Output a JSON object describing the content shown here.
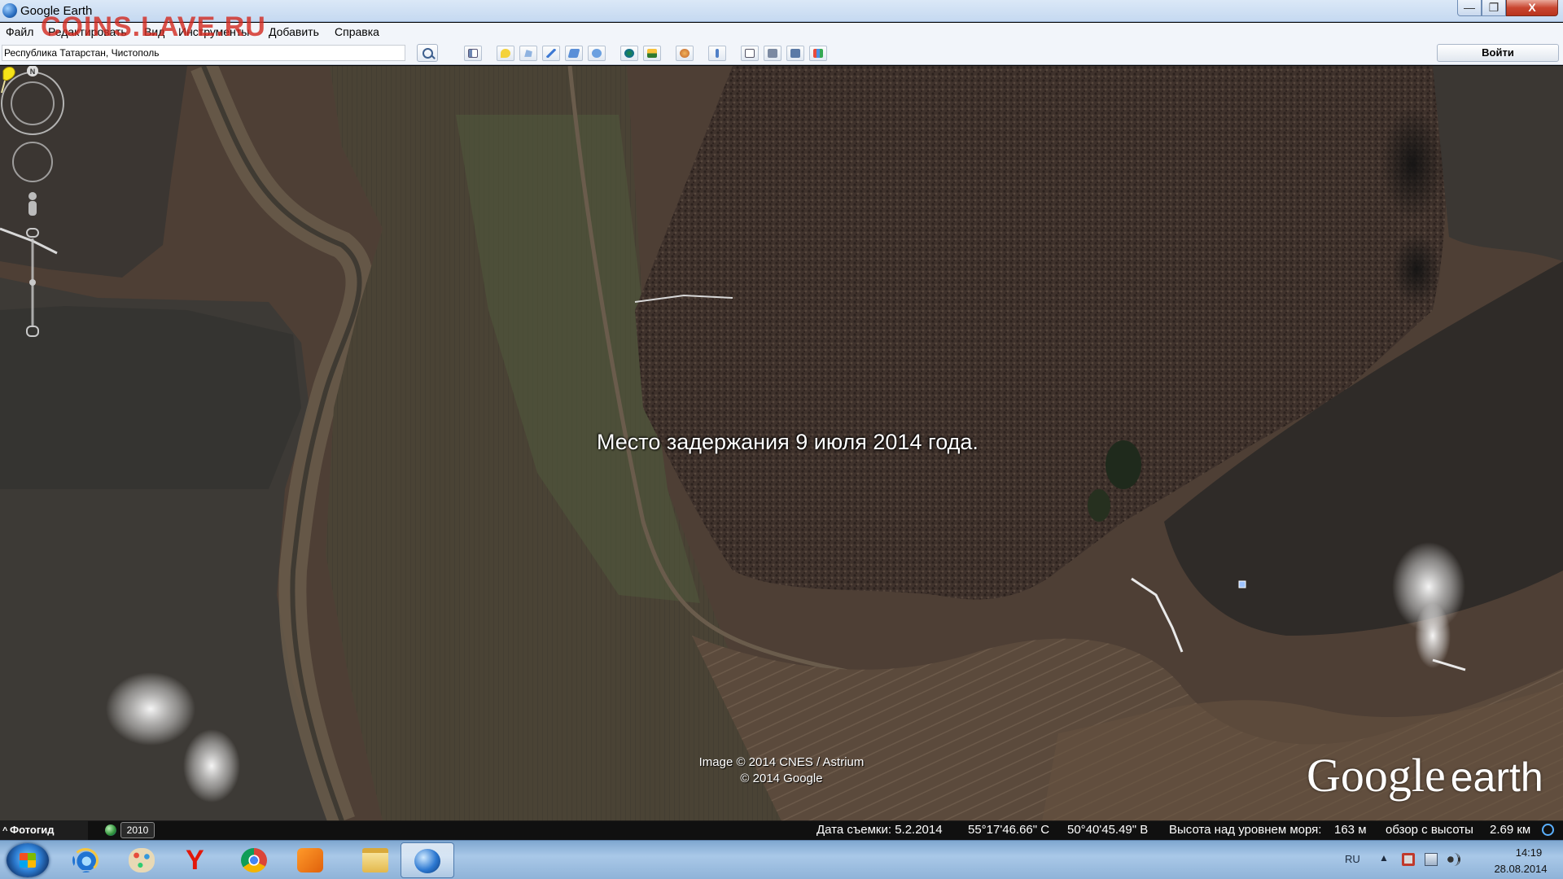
{
  "window": {
    "title": "Google Earth",
    "min": "—",
    "max": "❐",
    "close": "X"
  },
  "watermark": "COINS.LAVE.RU",
  "menu": [
    "Файл",
    "Редактировать",
    "Вид",
    "Инструменты",
    "Добавить",
    "Справка"
  ],
  "search": {
    "value": "Республика Татарстан, Чистополь"
  },
  "toolbar": {
    "login_label": "Войти",
    "tools": [
      "sidebar-icon",
      "placemark-icon",
      "polygon-icon",
      "path-icon",
      "overlay-icon",
      "tour-icon",
      "historical-imagery-icon",
      "sunlight-icon",
      "planets-icon",
      "ruler-icon",
      "email-icon",
      "print-icon",
      "save-image-icon",
      "maps-icon"
    ]
  },
  "map": {
    "placemark_label": "Место задержания 9 июля 2014 года.",
    "credits_line1": "Image © 2014 CNES / Astrium",
    "credits_line2": "© 2014 Google",
    "logo_google": "Google",
    "logo_earth": "earth",
    "compass_n": "N"
  },
  "statusbar": {
    "tour_guide": "Фотогид",
    "history_year": "2010",
    "imagery_date": "Дата съемки: 5.2.2014",
    "lat": "55°17'46.66\" С",
    "lon": "50°40'45.49\" В",
    "elevation_label": "Высота над уровнем моря:",
    "elevation_value": "163 м",
    "eye_label": "обзор с высоты",
    "eye_value": "2.69 км"
  },
  "taskbar": {
    "apps": [
      "internet-explorer-icon",
      "paint-icon",
      "yandex-browser-icon",
      "chrome-icon",
      "media-player-icon",
      "explorer-icon",
      "google-earth-icon"
    ],
    "lang": "RU",
    "time": "14:19",
    "date": "28.08.2014"
  }
}
